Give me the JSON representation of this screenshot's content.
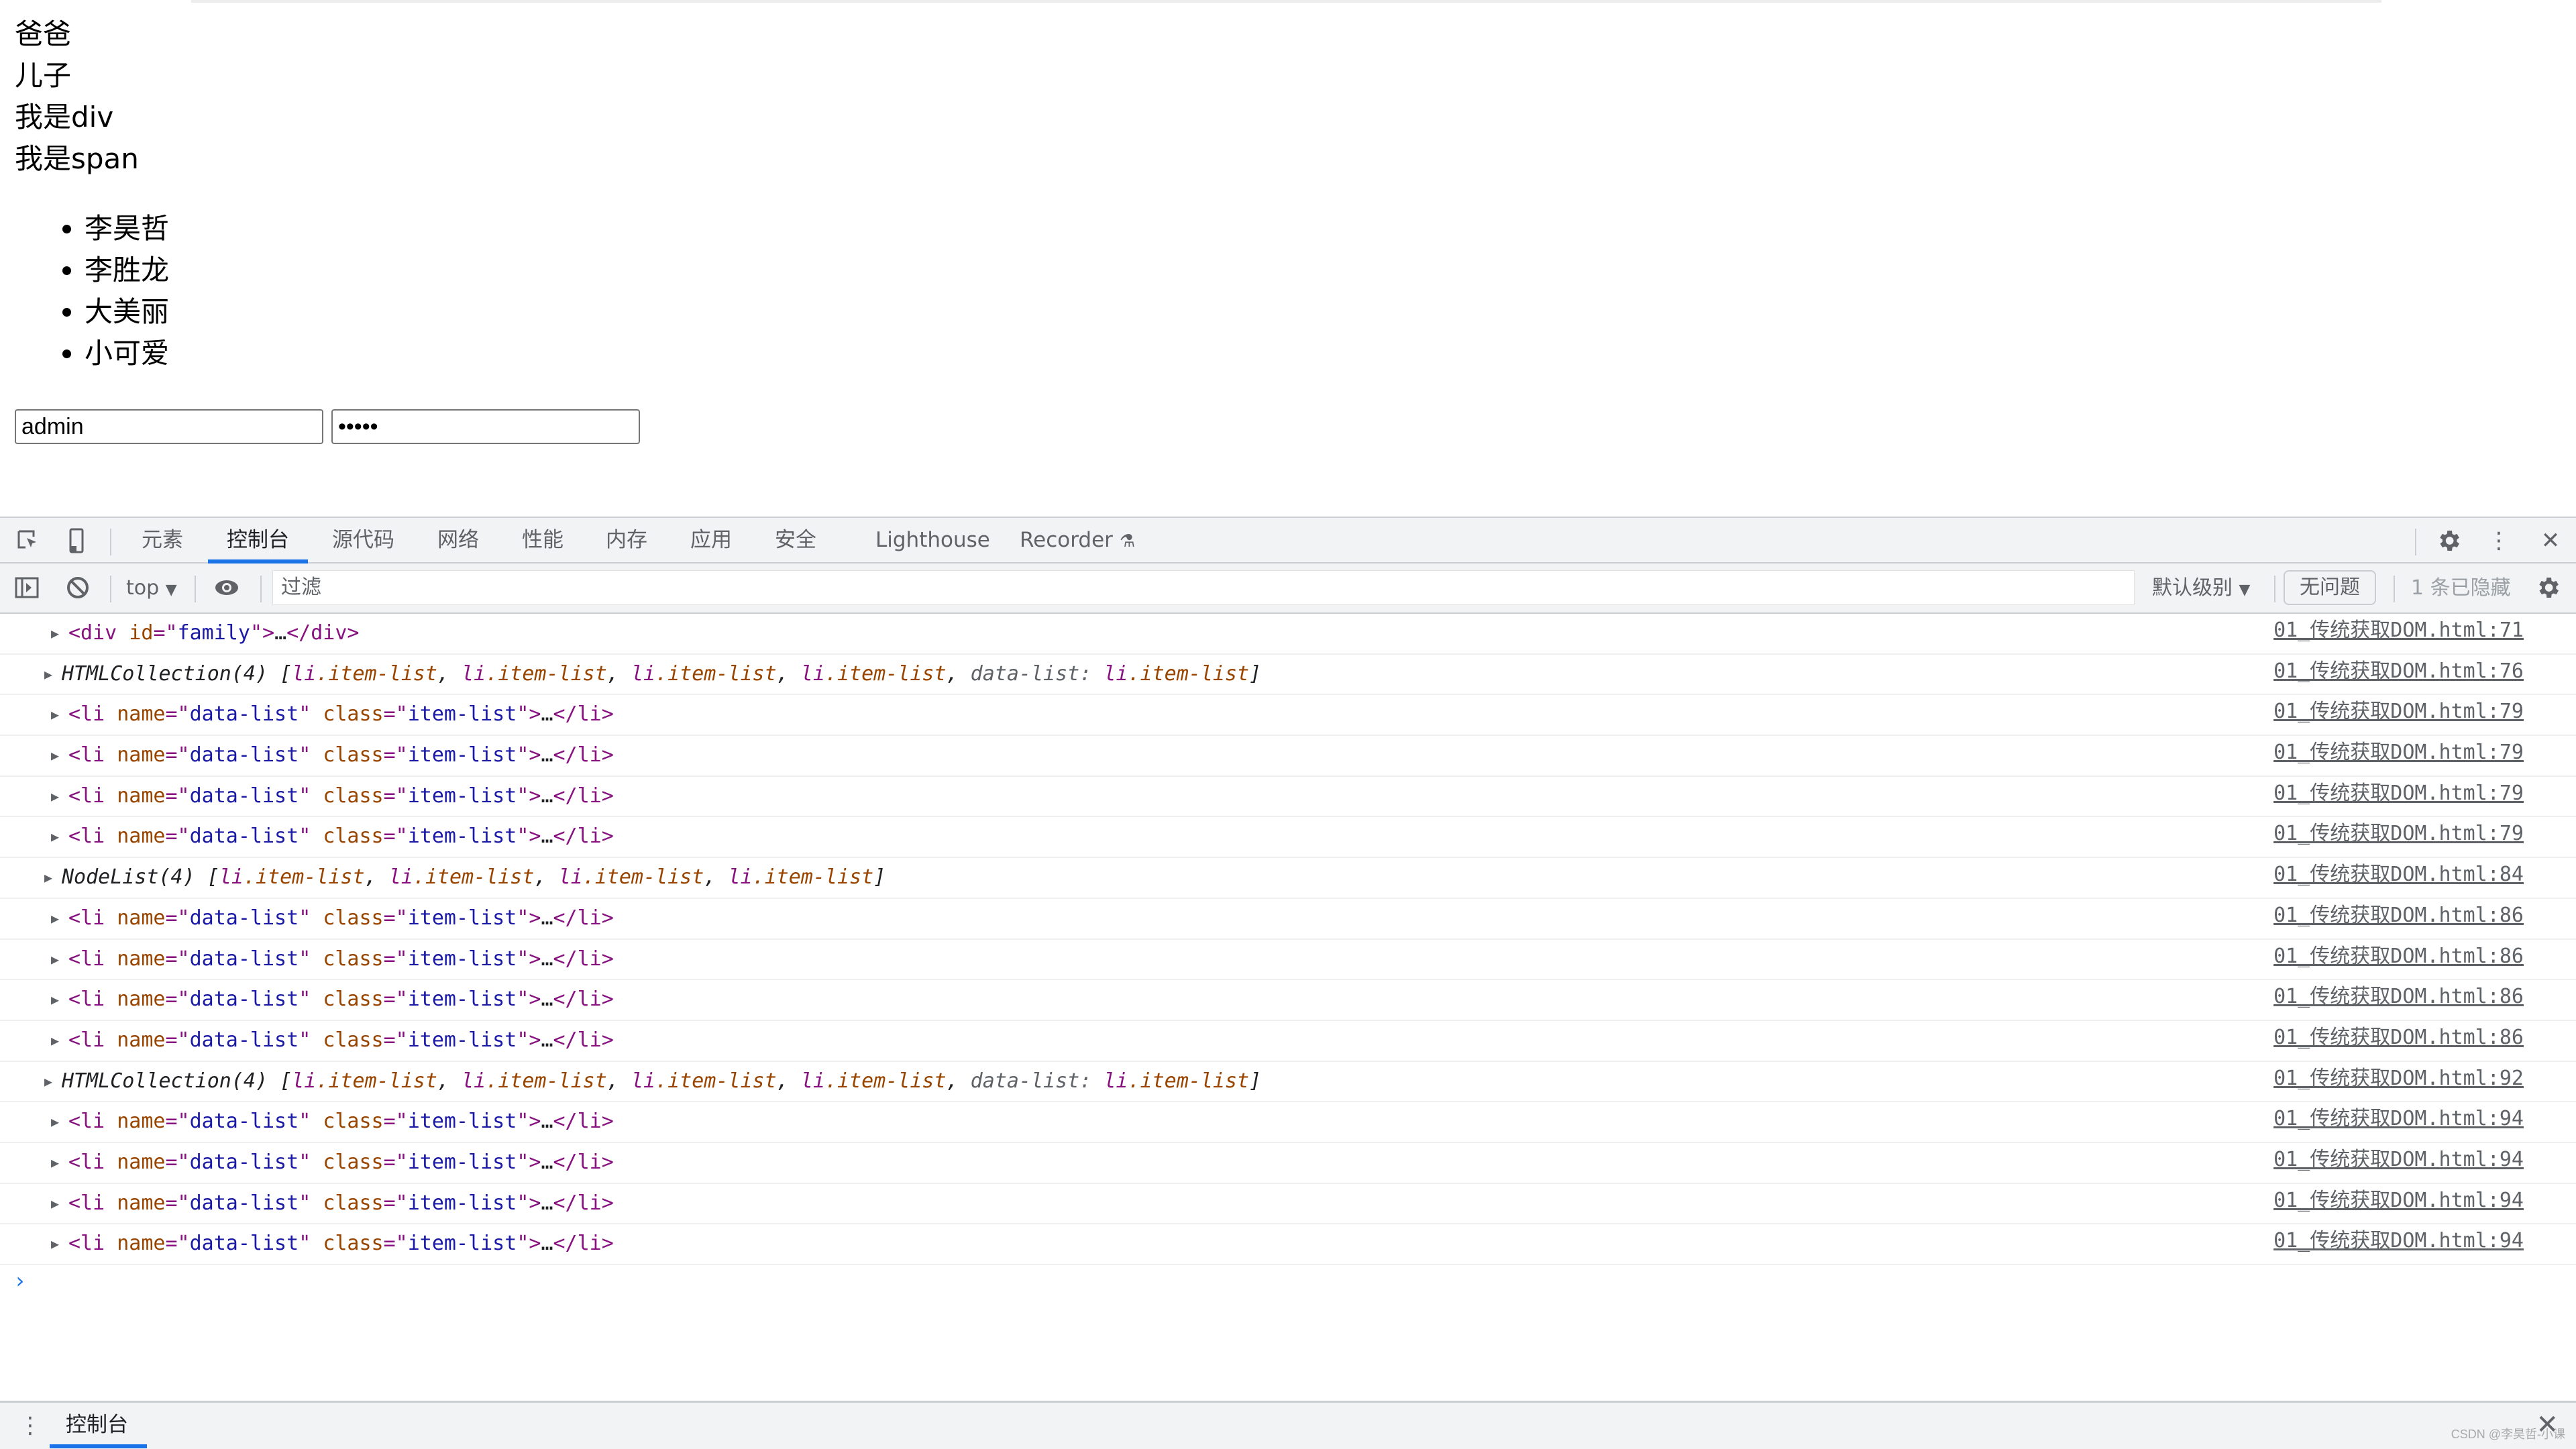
{
  "page": {
    "lines": [
      "爸爸",
      "儿子",
      "我是div",
      "我是span"
    ],
    "list_items": [
      "李昊哲",
      "李胜龙",
      "大美丽",
      "小可爱"
    ],
    "username_value": "admin",
    "password_value": "•••••"
  },
  "devtools": {
    "icons": {
      "inspect": "inspect-element-icon",
      "device": "device-toolbar-icon",
      "settings": "gear-icon",
      "more": "more-vertical-icon",
      "close": "close-icon"
    },
    "tabs": [
      {
        "label": "元素",
        "active": false
      },
      {
        "label": "控制台",
        "active": true
      },
      {
        "label": "源代码",
        "active": false
      },
      {
        "label": "网络",
        "active": false
      },
      {
        "label": "性能",
        "active": false
      },
      {
        "label": "内存",
        "active": false
      },
      {
        "label": "应用",
        "active": false
      },
      {
        "label": "安全",
        "active": false
      },
      {
        "label": "Lighthouse",
        "active": false
      },
      {
        "label": "Recorder",
        "active": false
      }
    ],
    "recorder_badge": "⚗",
    "filterbar": {
      "context": "top",
      "filter_placeholder": "过滤",
      "level": "默认级别",
      "issues": "无问题",
      "hidden_count": "1 条已隐藏"
    },
    "console_rows": [
      {
        "type": "el",
        "tag": "div",
        "attrs": [
          [
            "id",
            "family"
          ]
        ],
        "src": "01_传统获取DOM.html:71"
      },
      {
        "type": "coll",
        "prefix": "HTMLCollection(4)",
        "items": [
          "li.item-list",
          "li.item-list",
          "li.item-list",
          "li.item-list"
        ],
        "named": "data-list",
        "named_value": "li.item-list",
        "src": "01_传统获取DOM.html:76"
      },
      {
        "type": "el",
        "tag": "li",
        "attrs": [
          [
            "name",
            "data-list"
          ],
          [
            "class",
            "item-list"
          ]
        ],
        "src": "01_传统获取DOM.html:79"
      },
      {
        "type": "el",
        "tag": "li",
        "attrs": [
          [
            "name",
            "data-list"
          ],
          [
            "class",
            "item-list"
          ]
        ],
        "src": "01_传统获取DOM.html:79"
      },
      {
        "type": "el",
        "tag": "li",
        "attrs": [
          [
            "name",
            "data-list"
          ],
          [
            "class",
            "item-list"
          ]
        ],
        "src": "01_传统获取DOM.html:79"
      },
      {
        "type": "el",
        "tag": "li",
        "attrs": [
          [
            "name",
            "data-list"
          ],
          [
            "class",
            "item-list"
          ]
        ],
        "src": "01_传统获取DOM.html:79"
      },
      {
        "type": "coll",
        "prefix": "NodeList(4)",
        "items": [
          "li.item-list",
          "li.item-list",
          "li.item-list",
          "li.item-list"
        ],
        "named": null,
        "src": "01_传统获取DOM.html:84"
      },
      {
        "type": "el",
        "tag": "li",
        "attrs": [
          [
            "name",
            "data-list"
          ],
          [
            "class",
            "item-list"
          ]
        ],
        "src": "01_传统获取DOM.html:86"
      },
      {
        "type": "el",
        "tag": "li",
        "attrs": [
          [
            "name",
            "data-list"
          ],
          [
            "class",
            "item-list"
          ]
        ],
        "src": "01_传统获取DOM.html:86"
      },
      {
        "type": "el",
        "tag": "li",
        "attrs": [
          [
            "name",
            "data-list"
          ],
          [
            "class",
            "item-list"
          ]
        ],
        "src": "01_传统获取DOM.html:86"
      },
      {
        "type": "el",
        "tag": "li",
        "attrs": [
          [
            "name",
            "data-list"
          ],
          [
            "class",
            "item-list"
          ]
        ],
        "src": "01_传统获取DOM.html:86"
      },
      {
        "type": "coll",
        "prefix": "HTMLCollection(4)",
        "items": [
          "li.item-list",
          "li.item-list",
          "li.item-list",
          "li.item-list"
        ],
        "named": "data-list",
        "named_value": "li.item-list",
        "src": "01_传统获取DOM.html:92"
      },
      {
        "type": "el",
        "tag": "li",
        "attrs": [
          [
            "name",
            "data-list"
          ],
          [
            "class",
            "item-list"
          ]
        ],
        "src": "01_传统获取DOM.html:94"
      },
      {
        "type": "el",
        "tag": "li",
        "attrs": [
          [
            "name",
            "data-list"
          ],
          [
            "class",
            "item-list"
          ]
        ],
        "src": "01_传统获取DOM.html:94"
      },
      {
        "type": "el",
        "tag": "li",
        "attrs": [
          [
            "name",
            "data-list"
          ],
          [
            "class",
            "item-list"
          ]
        ],
        "src": "01_传统获取DOM.html:94"
      },
      {
        "type": "el",
        "tag": "li",
        "attrs": [
          [
            "name",
            "data-list"
          ],
          [
            "class",
            "item-list"
          ]
        ],
        "src": "01_传统获取DOM.html:94"
      }
    ],
    "prompt_symbol": "›",
    "drawer": {
      "tab_label": "控制台"
    }
  },
  "watermark": "CSDN @李昊哲-小课",
  "colors": {
    "accent": "#1a73e8",
    "tag": "#881280",
    "attr": "#994500",
    "value": "#1a1aa6",
    "panel_bg": "#f1f3f4"
  }
}
